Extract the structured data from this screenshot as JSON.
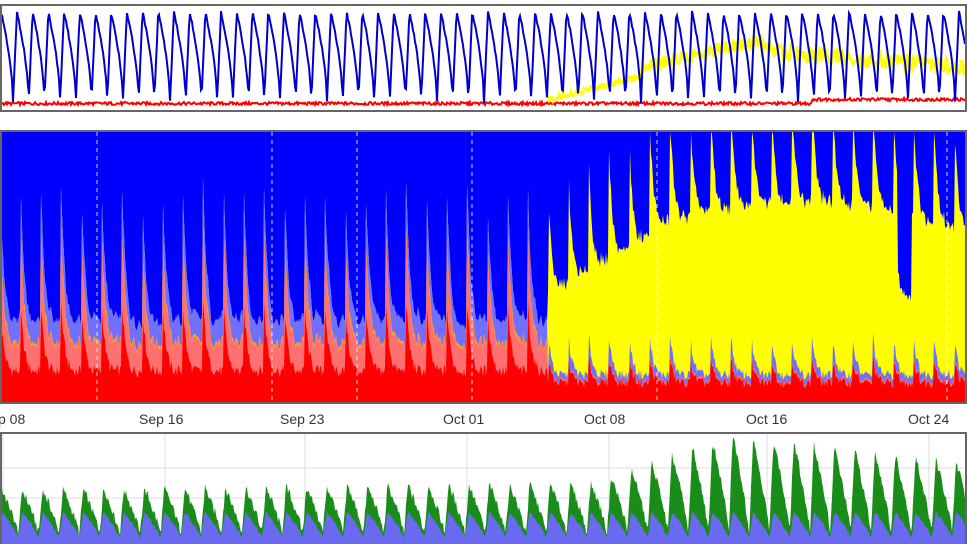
{
  "chart_data": [
    {
      "type": "line",
      "series": [
        {
          "color": "#0000cc",
          "pattern": "daily-oscillation"
        },
        {
          "color": "#ffff00",
          "pattern": "rises-after-oct-05"
        },
        {
          "color": "#ff0000",
          "pattern": "low-baseline"
        }
      ],
      "grid": false
    },
    {
      "type": "area",
      "stacked": true,
      "x_ticks": [
        "p 08",
        "Sep 16",
        "Sep 23",
        "Oct 01",
        "Oct 08",
        "Oct 16",
        "Oct 24"
      ],
      "series": [
        {
          "color": "#ff0000"
        },
        {
          "color": "#ff7070"
        },
        {
          "color": "#ffa020"
        },
        {
          "color": "#7070ff"
        },
        {
          "color": "#ffff00"
        },
        {
          "color": "#0000ff"
        }
      ],
      "grid": "dashed-vertical"
    },
    {
      "type": "area",
      "stacked": true,
      "series": [
        {
          "color": "#6a6af0"
        },
        {
          "color": "#1a8c1a"
        }
      ],
      "grid": true
    }
  ]
}
